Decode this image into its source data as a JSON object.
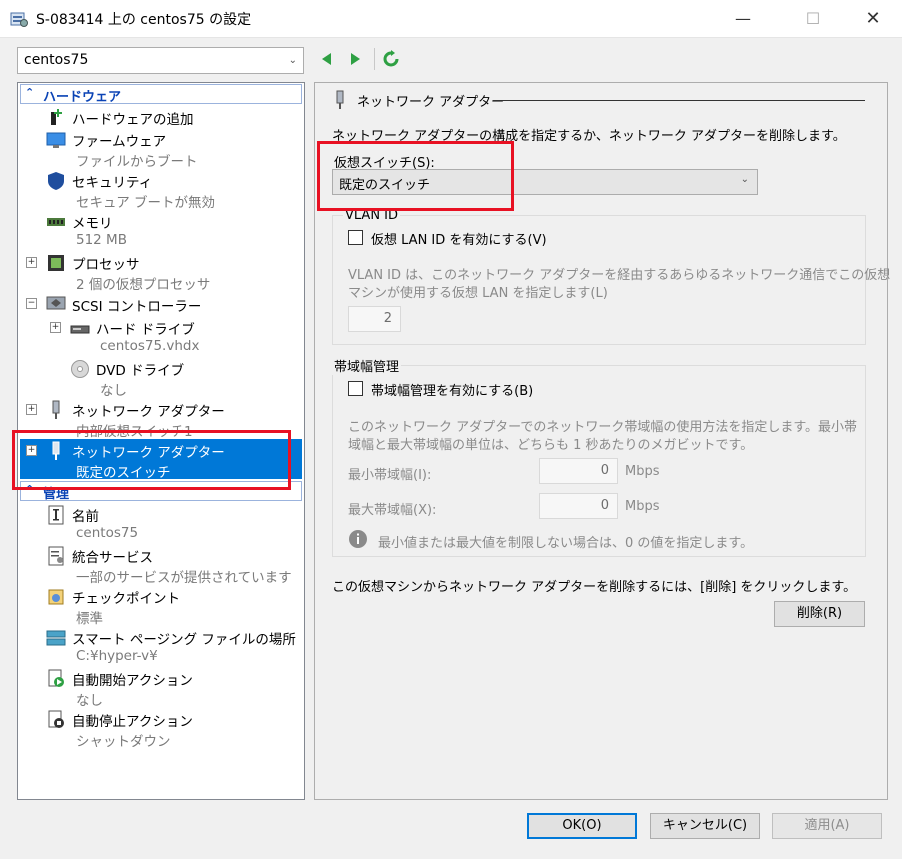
{
  "window": {
    "title": "S-083414 上の centos75 の設定",
    "minimize_glyph": "—",
    "maximize_glyph": "☐",
    "close_glyph": "✕"
  },
  "vm_selector": {
    "value": "centos75",
    "chevron": "⌄"
  },
  "tree": {
    "hardware_header": "ハードウェア",
    "hardware_caret": "⌃",
    "management_header": "管理",
    "management_caret": "⌃",
    "items": [
      {
        "name": "add-hardware",
        "icon": "add-hardware-icon",
        "label": "ハードウェアの追加",
        "sub": ""
      },
      {
        "name": "firmware",
        "icon": "monitor-icon",
        "label": "ファームウェア",
        "sub": "ファイルからブート"
      },
      {
        "name": "security",
        "icon": "shield-icon",
        "label": "セキュリティ",
        "sub": "セキュア ブートが無効"
      },
      {
        "name": "memory",
        "icon": "memory-icon",
        "label": "メモリ",
        "sub": "512 MB"
      },
      {
        "name": "processor",
        "icon": "cpu-icon",
        "label": "プロセッサ",
        "sub": "2 個の仮想プロセッサ"
      },
      {
        "name": "scsi-controller",
        "icon": "scsi-icon",
        "label": "SCSI コントローラー",
        "sub": ""
      },
      {
        "name": "hard-drive",
        "icon": "hard-drive-icon",
        "label": "ハード ドライブ",
        "sub": "centos75.vhdx"
      },
      {
        "name": "dvd-drive",
        "icon": "dvd-icon",
        "label": "DVD ドライブ",
        "sub": "なし"
      },
      {
        "name": "network-adapter-1",
        "icon": "network-adapter-icon",
        "label": "ネットワーク アダプター",
        "sub": "内部仮想スイッチ1"
      },
      {
        "name": "network-adapter-2",
        "icon": "network-adapter-icon",
        "label": "ネットワーク アダプター",
        "sub": "既定のスイッチ"
      },
      {
        "name": "vm-name",
        "icon": "name-icon",
        "label": "名前",
        "sub": "centos75"
      },
      {
        "name": "integration-services",
        "icon": "integration-icon",
        "label": "統合サービス",
        "sub": "一部のサービスが提供されています"
      },
      {
        "name": "checkpoints",
        "icon": "checkpoint-icon",
        "label": "チェックポイント",
        "sub": "標準"
      },
      {
        "name": "smart-paging",
        "icon": "paging-icon",
        "label": "スマート ページング ファイルの場所",
        "sub": "C:¥hyper-v¥"
      },
      {
        "name": "auto-start",
        "icon": "auto-start-icon",
        "label": "自動開始アクション",
        "sub": "なし"
      },
      {
        "name": "auto-stop",
        "icon": "auto-stop-icon",
        "label": "自動停止アクション",
        "sub": "シャットダウン"
      }
    ]
  },
  "panel": {
    "header": "ネットワーク アダプター",
    "description": "ネットワーク アダプターの構成を指定するか、ネットワーク アダプターを削除します。",
    "switch_label": "仮想スイッチ(S):",
    "switch_value": "既定のスイッチ",
    "vlan_group": "VLAN ID",
    "vlan_checkbox": "仮想 LAN ID を有効にする(V)",
    "vlan_desc_1": "VLAN ID は、このネットワーク アダプターを経由するあらゆるネットワーク通信でこの仮想",
    "vlan_desc_2": "マシンが使用する仮想 LAN を指定します(L)",
    "vlan_value": "2",
    "bw_group": "帯域幅管理",
    "bw_checkbox": "帯域幅管理を有効にする(B)",
    "bw_desc_1": "このネットワーク アダプターでのネットワーク帯域幅の使用方法を指定します。最小帯",
    "bw_desc_2": "域幅と最大帯域幅の単位は、どちらも 1 秒あたりのメガビットです。",
    "min_label": "最小帯域幅(I):",
    "min_value": "0",
    "min_unit": "Mbps",
    "max_label": "最大帯域幅(X):",
    "max_value": "0",
    "max_unit": "Mbps",
    "info_text": "最小値または最大値を制限しない場合は、0 の値を指定します。",
    "remove_text": "この仮想マシンからネットワーク アダプターを削除するには、[削除] をクリックします。",
    "remove_button": "削除(R)"
  },
  "footer": {
    "ok": "OK(O)",
    "cancel": "キャンセル(C)",
    "apply": "適用(A)"
  },
  "colors": {
    "selection": "#0078d7",
    "highlight": "#e81123",
    "header_text": "#0a43b5"
  }
}
